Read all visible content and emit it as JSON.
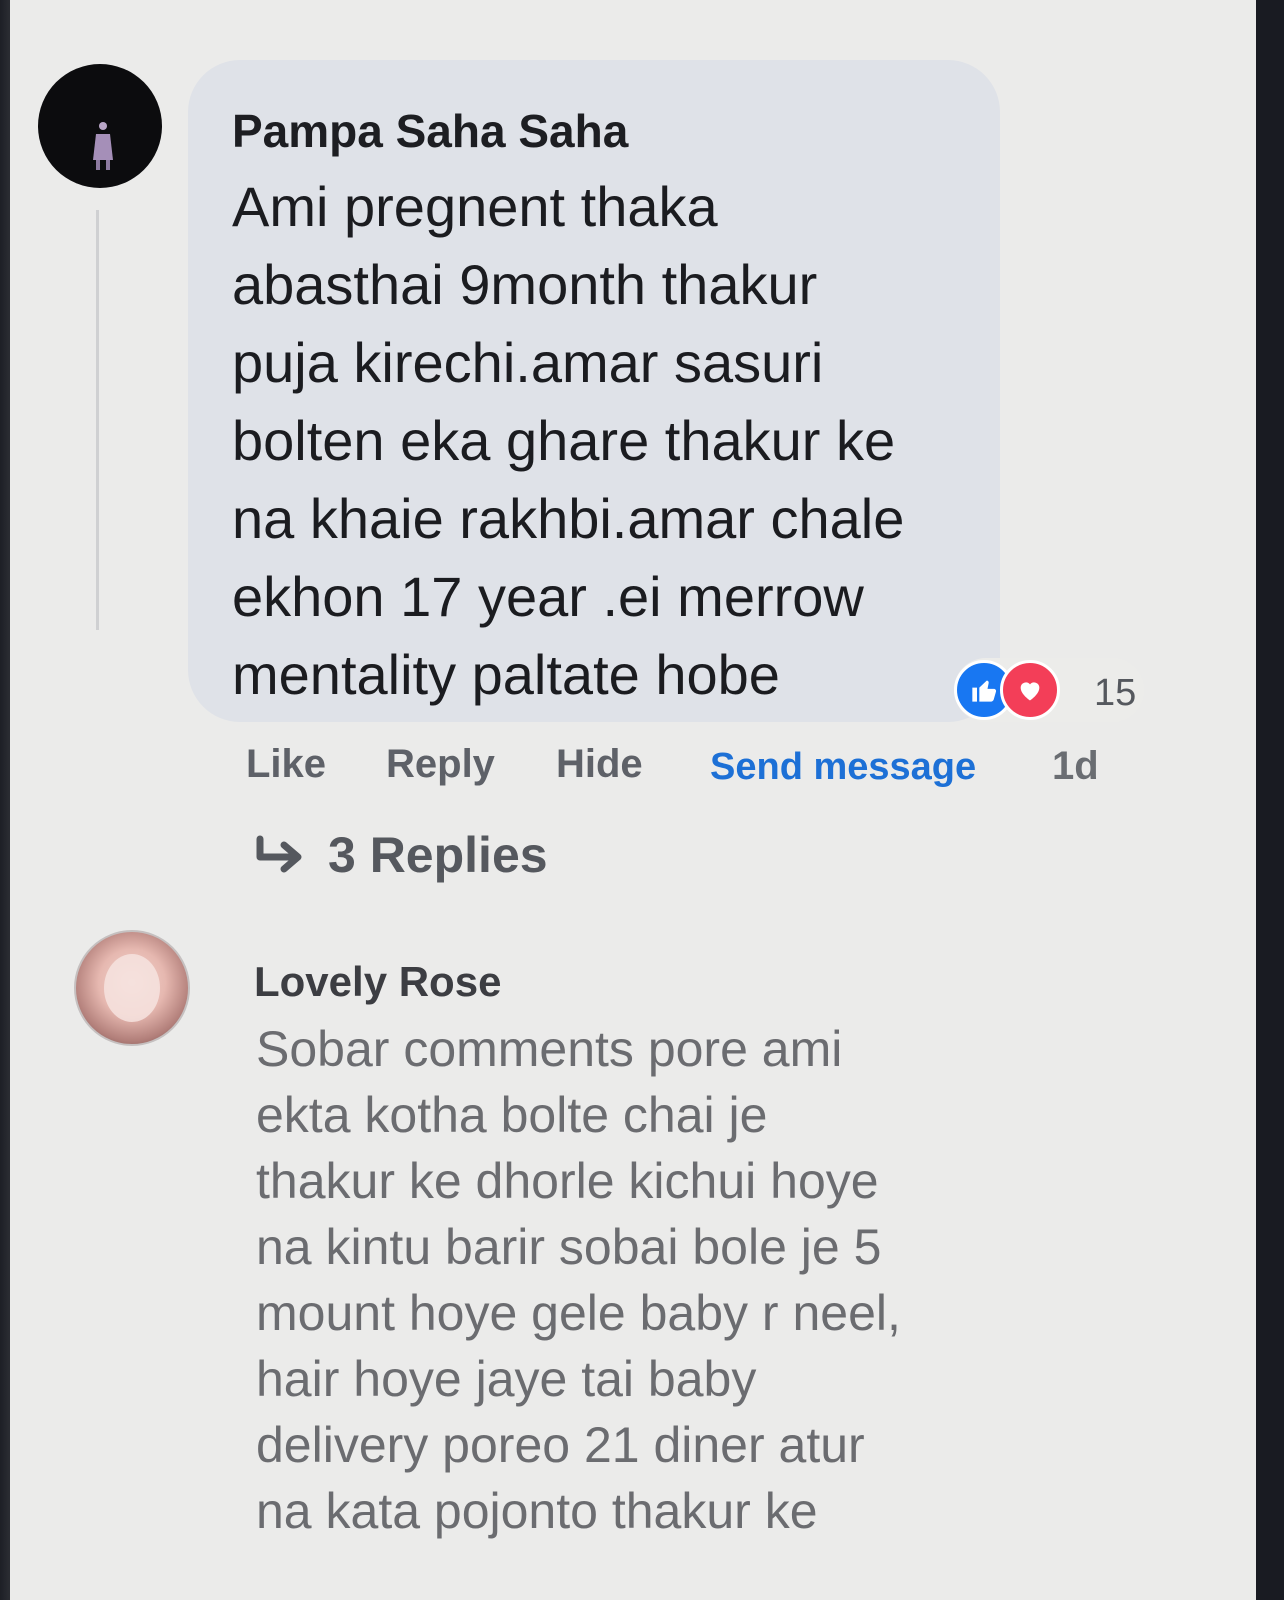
{
  "comments": [
    {
      "author": "Pampa Saha Saha",
      "text": "Ami pregnent thaka\nabasthai 9month thakur\npuja kirechi.amar sasuri\nbolten eka ghare thakur ke\nna khaie rakhbi.amar chale\nekhon 17 year .ei merrow\nmentality paltate hobe",
      "reactions": {
        "icons": [
          "like-icon",
          "love-icon"
        ],
        "count": "15"
      },
      "actions": {
        "like": "Like",
        "reply": "Reply",
        "hide": "Hide",
        "send_message": "Send message",
        "time": "1d"
      },
      "replies_label": "3 Replies"
    },
    {
      "author": "Lovely Rose",
      "text": "Sobar comments pore ami\nekta kotha bolte chai je\nthakur ke dhorle kichui hoye\nna kintu barir sobai bole je 5\nmount hoye gele baby r neel,\nhair hoye jaye tai baby\ndelivery poreo 21 diner atur\nna kata pojonto thakur ke"
    }
  ],
  "colors": {
    "accent": "#1d70d6",
    "like": "#1877f2",
    "love": "#f33e58"
  }
}
